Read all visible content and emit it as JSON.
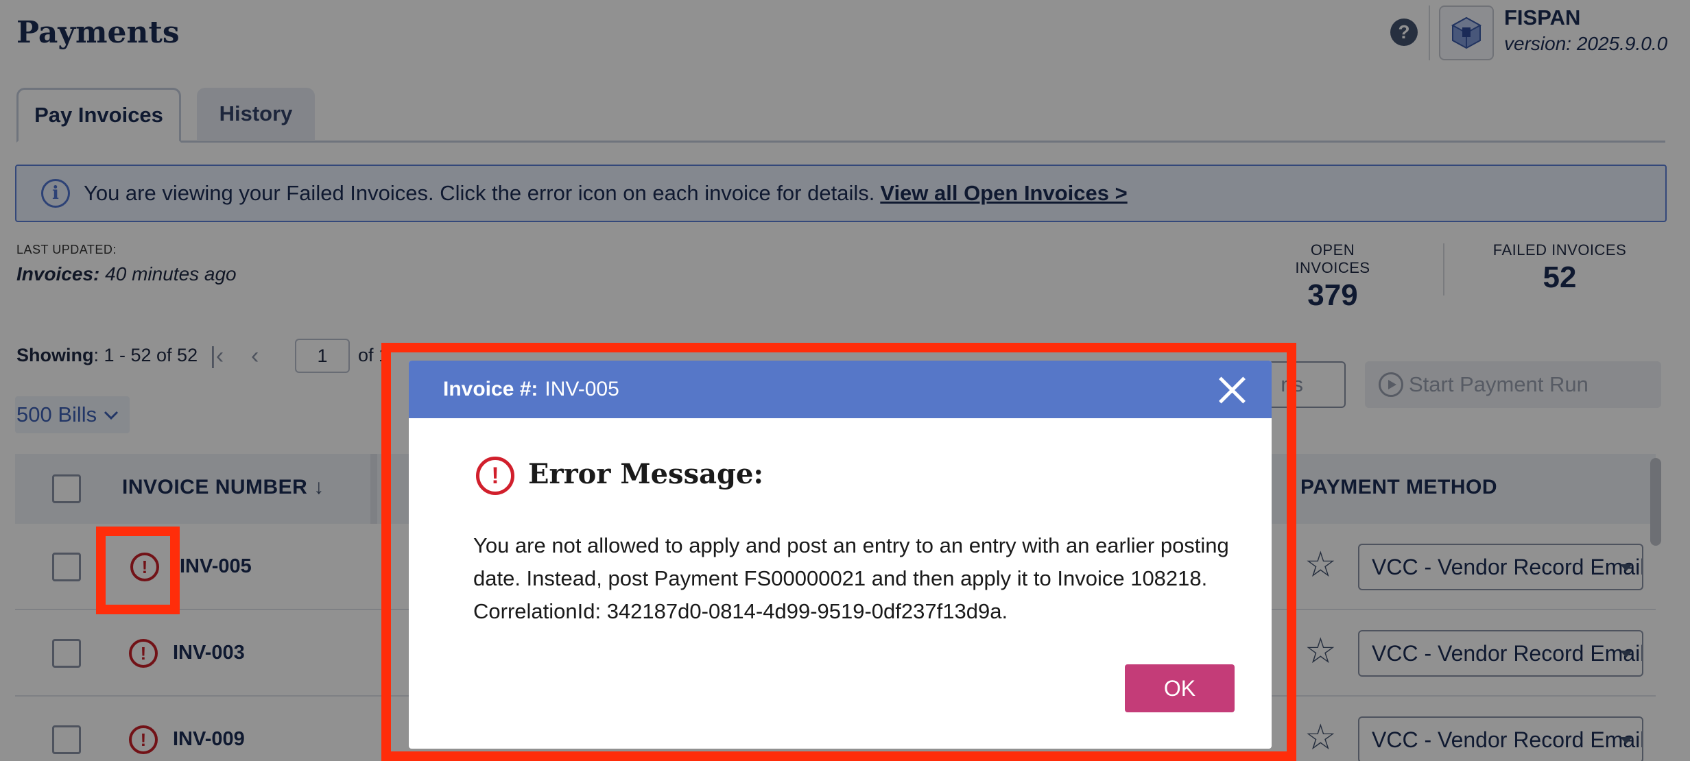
{
  "header": {
    "title": "Payments",
    "brand_name": "FISPAN",
    "version": "version: 2025.9.0.0"
  },
  "tabs": [
    {
      "label": "Pay Invoices",
      "active": true
    },
    {
      "label": "History",
      "active": false
    }
  ],
  "banner": {
    "text": "You are viewing your Failed Invoices. Click the error icon on each invoice for details.",
    "link": "View all Open Invoices >"
  },
  "last_updated": {
    "label": "LAST UPDATED:",
    "prefix": "Invoices:",
    "value": "40 minutes ago"
  },
  "stats": {
    "open_label": "OPEN INVOICES",
    "open_value": "379",
    "failed_label": "FAILED INVOICES",
    "failed_value": "52"
  },
  "pagination": {
    "showing_label": "Showing",
    "showing_value": ": 1 - 52 of 52",
    "page": "1",
    "of_text": "of 1",
    "bills": "500 Bills"
  },
  "actions": {
    "partial_button": "ns",
    "start_button": "Start Payment Run"
  },
  "table": {
    "columns": {
      "invoice_number": "INVOICE NUMBER",
      "payment_method": "PAYMENT METHOD"
    },
    "rows": [
      {
        "invoice": "INV-005",
        "payment_method": "VCC - Vendor Record Email"
      },
      {
        "invoice": "INV-003",
        "payment_method": "VCC - Vendor Record Email"
      },
      {
        "invoice": "INV-009",
        "payment_method": "VCC - Vendor Record Email"
      }
    ]
  },
  "modal": {
    "header_label": "Invoice #:",
    "header_value": "INV-005",
    "title": "Error Message:",
    "message": "You are not allowed to apply and post an entry to an entry with an earlier posting date.  Instead, post Payment FS00000021 and then apply it to Invoice 108218. CorrelationId: 342187d0-0814-4d99-9519-0df237f13d9a.",
    "ok_label": "OK"
  },
  "colors": {
    "accent": "#5677c8",
    "error": "#c8202a",
    "ok_button": "#c43c78",
    "highlight": "#ff2d0a"
  }
}
